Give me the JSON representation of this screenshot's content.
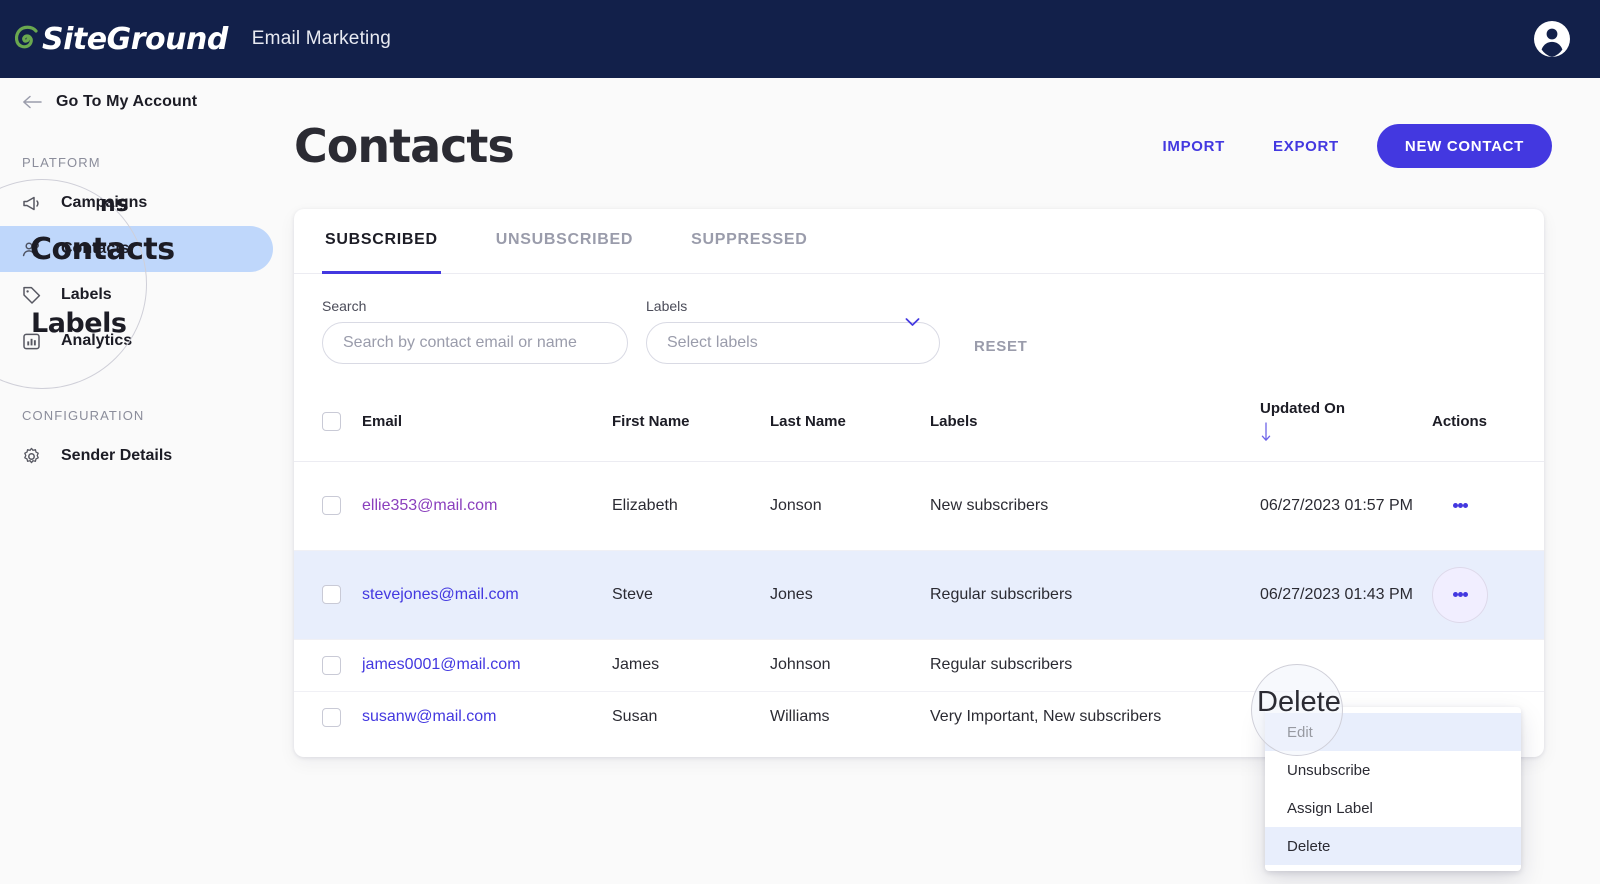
{
  "topbar": {
    "brand": "SiteGround",
    "app_title": "Email Marketing",
    "avatar_icon": "user-circle-icon"
  },
  "sidebar": {
    "back_label": "Go To My Account",
    "back_icon": "arrow-left-icon",
    "sections": [
      {
        "title": "PLATFORM"
      },
      {
        "title": "CONFIGURATION"
      }
    ],
    "items": [
      {
        "label": "Campaigns",
        "icon": "megaphone-icon",
        "active": false,
        "magnified_fragment": "ns"
      },
      {
        "label": "Contacts",
        "icon": "contacts-icon",
        "active": true
      },
      {
        "label": "Labels",
        "icon": "tag-icon",
        "active": false
      },
      {
        "label": "Analytics",
        "icon": "bar-chart-icon",
        "active": false
      },
      {
        "label": "Sender Details",
        "icon": "gear-icon",
        "active": false
      }
    ]
  },
  "page": {
    "title": "Contacts",
    "import_label": "IMPORT",
    "export_label": "EXPORT",
    "new_contact_label": "NEW CONTACT"
  },
  "tabs": [
    {
      "label": "SUBSCRIBED",
      "active": true
    },
    {
      "label": "UNSUBSCRIBED",
      "active": false
    },
    {
      "label": "SUPPRESSED",
      "active": false
    }
  ],
  "filters": {
    "search_label": "Search",
    "search_placeholder": "Search by contact email or name",
    "search_value": "",
    "labels_label": "Labels",
    "labels_value": "Select labels",
    "chevron_icon": "chevron-down-icon",
    "reset_label": "RESET"
  },
  "table": {
    "columns": {
      "email": "Email",
      "first_name": "First Name",
      "last_name": "Last Name",
      "labels": "Labels",
      "updated_on": "Updated On",
      "actions": "Actions"
    },
    "sort_icon": "sort-descending-arrow-icon",
    "rows": [
      {
        "email": "ellie353@mail.com",
        "first_name": "Elizabeth",
        "last_name": "Jonson",
        "labels": "New subscribers",
        "updated_on": "06/27/2023 01:57 PM",
        "checked": false,
        "highlighted": false,
        "visited": true
      },
      {
        "email": "stevejones@mail.com",
        "first_name": "Steve",
        "last_name": "Jones",
        "labels": "Regular subscribers",
        "updated_on": "06/27/2023 01:43 PM",
        "checked": false,
        "highlighted": true,
        "visited": false
      },
      {
        "email": "james0001@mail.com",
        "first_name": "James",
        "last_name": "Johnson",
        "labels": "Regular subscribers",
        "updated_on": "",
        "checked": false,
        "highlighted": false,
        "visited": false
      },
      {
        "email": "susanw@mail.com",
        "first_name": "Susan",
        "last_name": "Williams",
        "labels": "Very Important, New subscribers",
        "updated_on": "",
        "checked": false,
        "highlighted": false,
        "visited": false
      }
    ]
  },
  "row_menu": {
    "items": [
      {
        "label": "Edit",
        "highlighted": true
      },
      {
        "label": "Unsubscribe",
        "highlighted": false
      },
      {
        "label": "Assign Label",
        "highlighted": false
      },
      {
        "label": "Delete",
        "highlighted": true
      }
    ]
  },
  "magnifier": {
    "sidebar_focus": "Contacts",
    "sidebar_secondary": "Labels",
    "sidebar_partial": "ns",
    "menu_focus": "Delete"
  },
  "colors": {
    "brand_dark": "#12204a",
    "accent": "#4338e0",
    "active_nav": "#bfd7fb",
    "row_highlight": "#e8eefc",
    "visited_link": "#8a3fbd",
    "logo_green": "#6aa84f"
  }
}
